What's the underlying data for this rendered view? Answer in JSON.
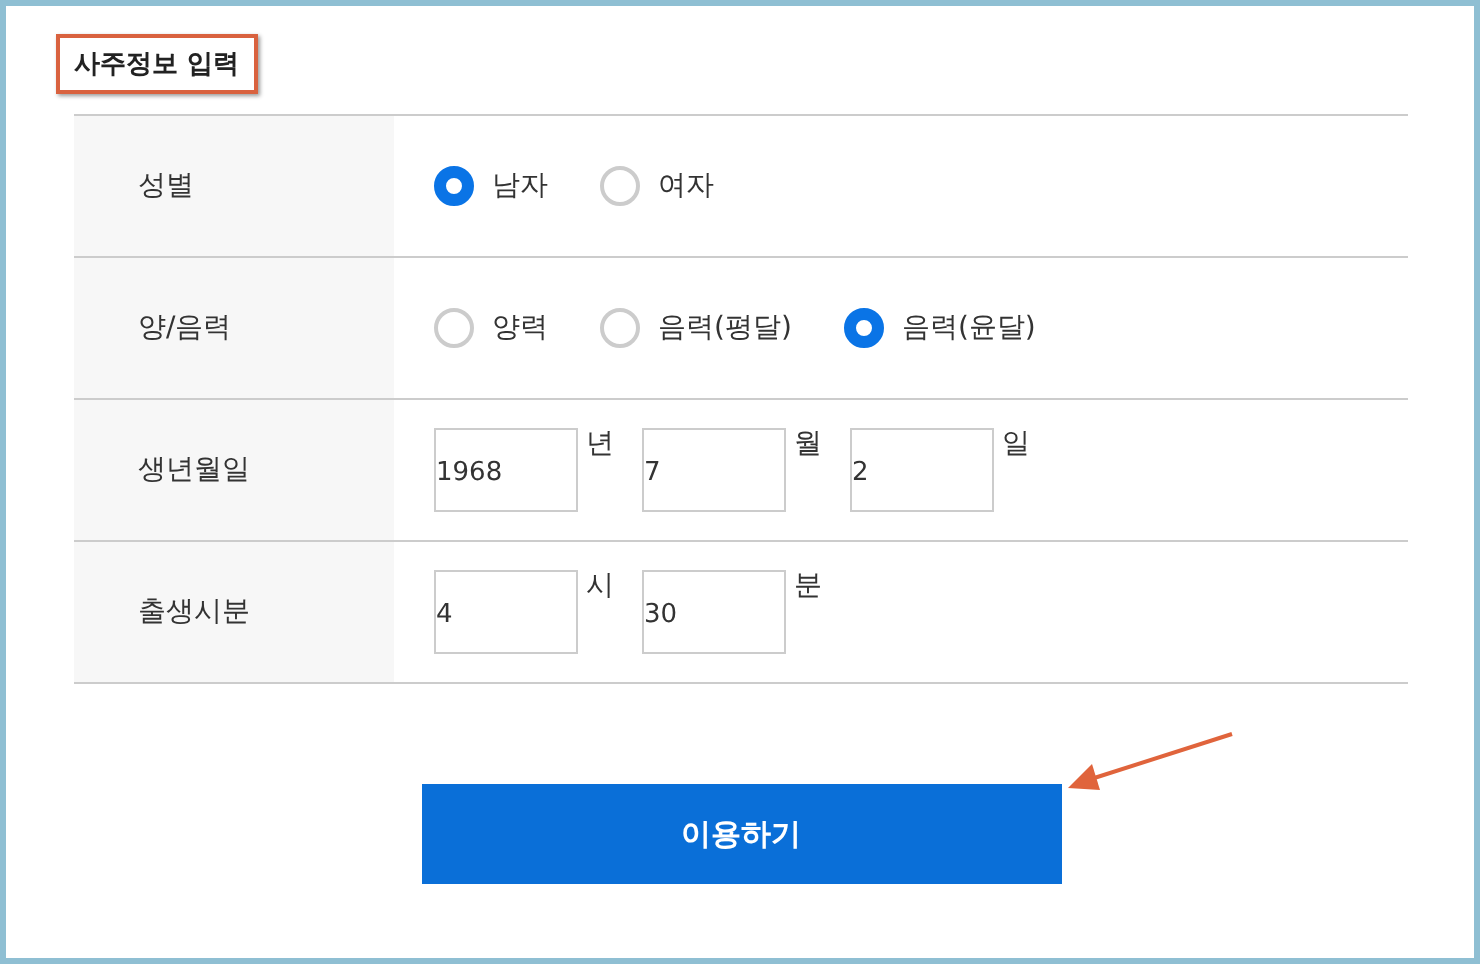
{
  "title": "사주정보 입력",
  "rows": [
    {
      "label": "성별",
      "kind": "radio",
      "options": [
        {
          "label": "남자",
          "selected": true
        },
        {
          "label": "여자",
          "selected": false
        }
      ]
    },
    {
      "label": "양/음력",
      "kind": "radio",
      "options": [
        {
          "label": "양력",
          "selected": false
        },
        {
          "label": "음력(평달)",
          "selected": false
        },
        {
          "label": "음력(윤달)",
          "selected": true
        }
      ]
    },
    {
      "label": "생년월일",
      "kind": "fields",
      "fields": [
        {
          "value": "1968",
          "unit": "년"
        },
        {
          "value": "7",
          "unit": "월"
        },
        {
          "value": "2",
          "unit": "일"
        }
      ]
    },
    {
      "label": "출생시분",
      "kind": "fields",
      "fields": [
        {
          "value": "4",
          "unit": "시"
        },
        {
          "value": "30",
          "unit": "분"
        }
      ]
    }
  ],
  "submit": "이용하기"
}
